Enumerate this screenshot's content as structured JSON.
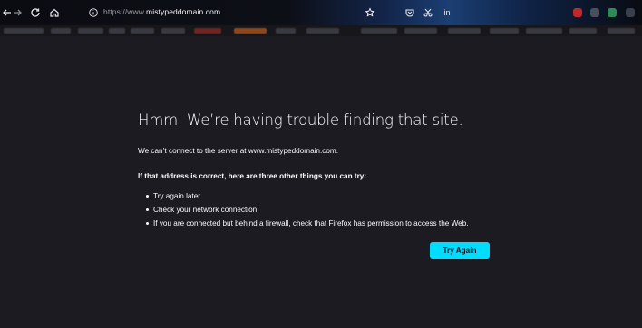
{
  "toolbar": {
    "back_icon": "arrow-left-icon",
    "forward_icon": "arrow-right-icon",
    "reload_icon": "reload-icon",
    "home_icon": "home-icon",
    "url_scheme": "https://www.",
    "url_host": "mistypeddomain.com",
    "bookmark_icon": "star-icon",
    "pocket_icon": "pocket-icon",
    "extensions_label": "in"
  },
  "page": {
    "title": "Hmm. We’re having trouble finding that site.",
    "description": "We can’t connect to the server at www.mistypeddomain.com.",
    "suggestions_heading": "If that address is correct, here are three other things you can try:",
    "suggestions": [
      "Try again later.",
      "Check your network connection.",
      "If you are connected but behind a firewall, check that Firefox has permission to access the Web."
    ],
    "try_again_label": "Try Again"
  },
  "colors": {
    "background": "#1c1b22",
    "text": "#fbfbfe",
    "accent": "#00ddff"
  }
}
